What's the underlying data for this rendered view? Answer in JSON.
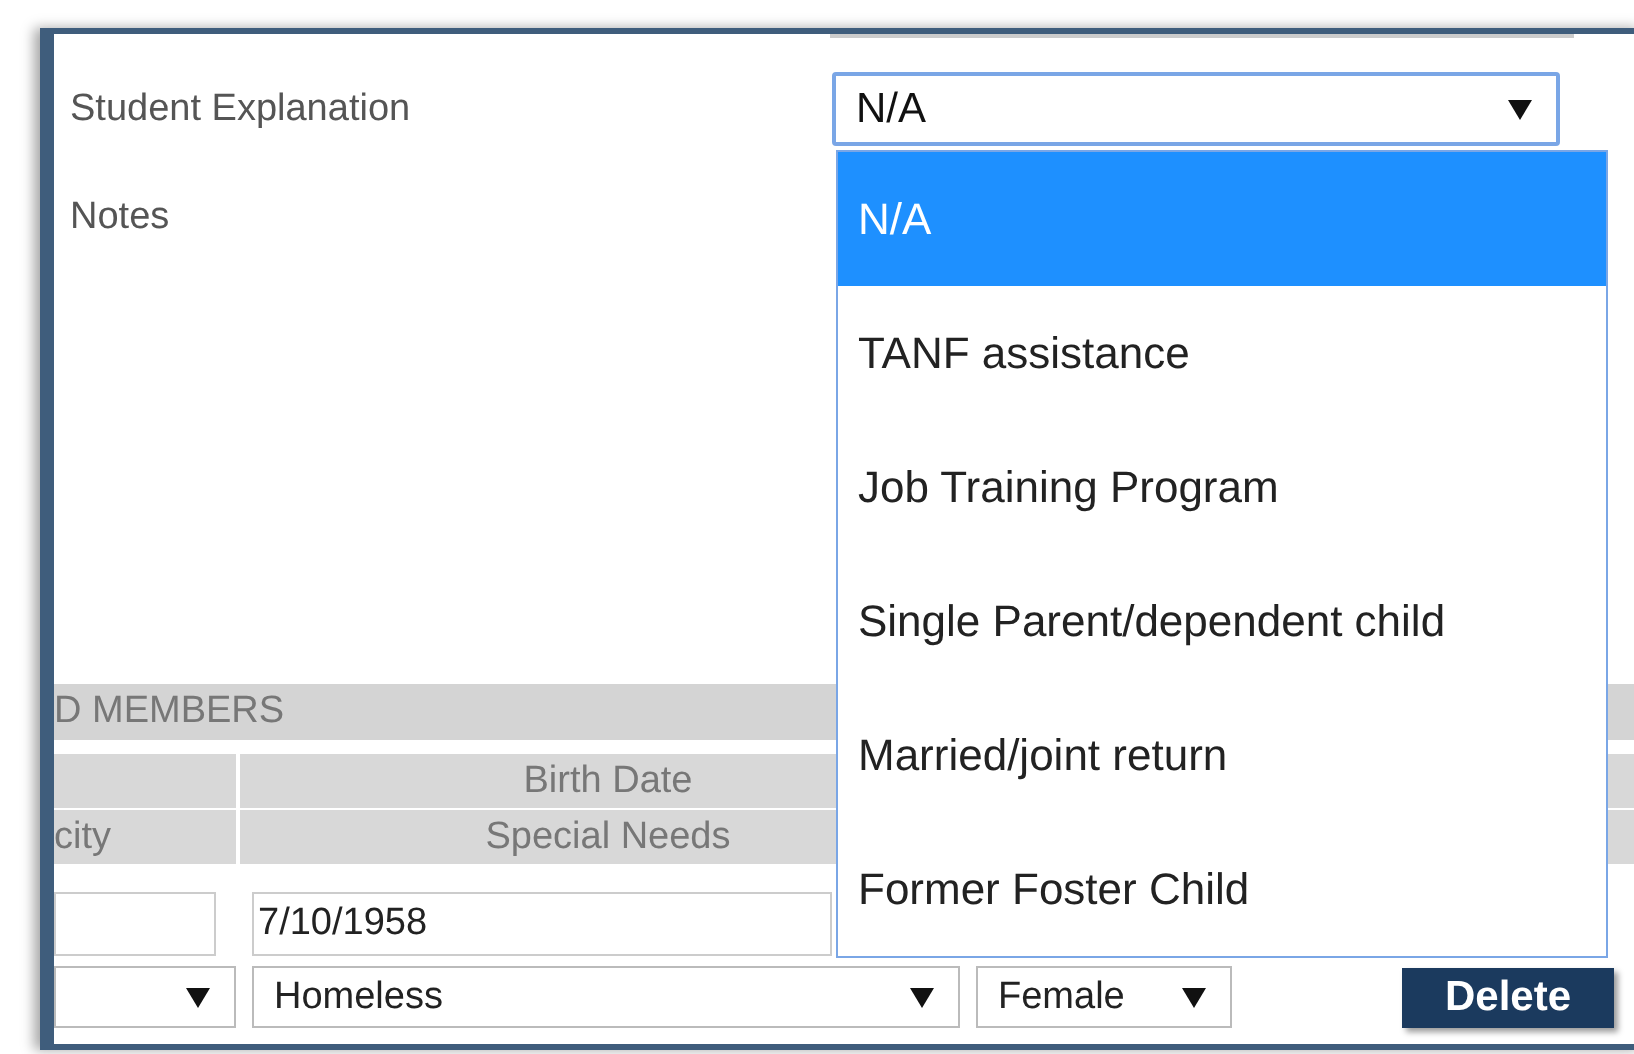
{
  "fields": [
    {
      "kind": "select",
      "label": "Student Explanation",
      "value": "N/A",
      "expanded": true
    },
    {
      "kind": "textarea",
      "label": "Notes"
    }
  ],
  "dropdown_options": [
    {
      "label": "N/A",
      "selected": true
    },
    {
      "label": "TANF assistance",
      "selected": false
    },
    {
      "label": "Job Training Program",
      "selected": false
    },
    {
      "label": "Single Parent/dependent child",
      "selected": false
    },
    {
      "label": "Married/joint return",
      "selected": false
    },
    {
      "label": "Former Foster Child",
      "selected": false
    }
  ],
  "household_members": {
    "title": "D MEMBERS",
    "columns": [
      {
        "heading_2": "city"
      },
      {
        "heading_1": "Birth Date",
        "heading_2": "Special Needs"
      }
    ],
    "member": {
      "birth_date": "7/10/1958",
      "special_needs": "Homeless",
      "gender": "Female",
      "delete_button": "Delete"
    }
  }
}
